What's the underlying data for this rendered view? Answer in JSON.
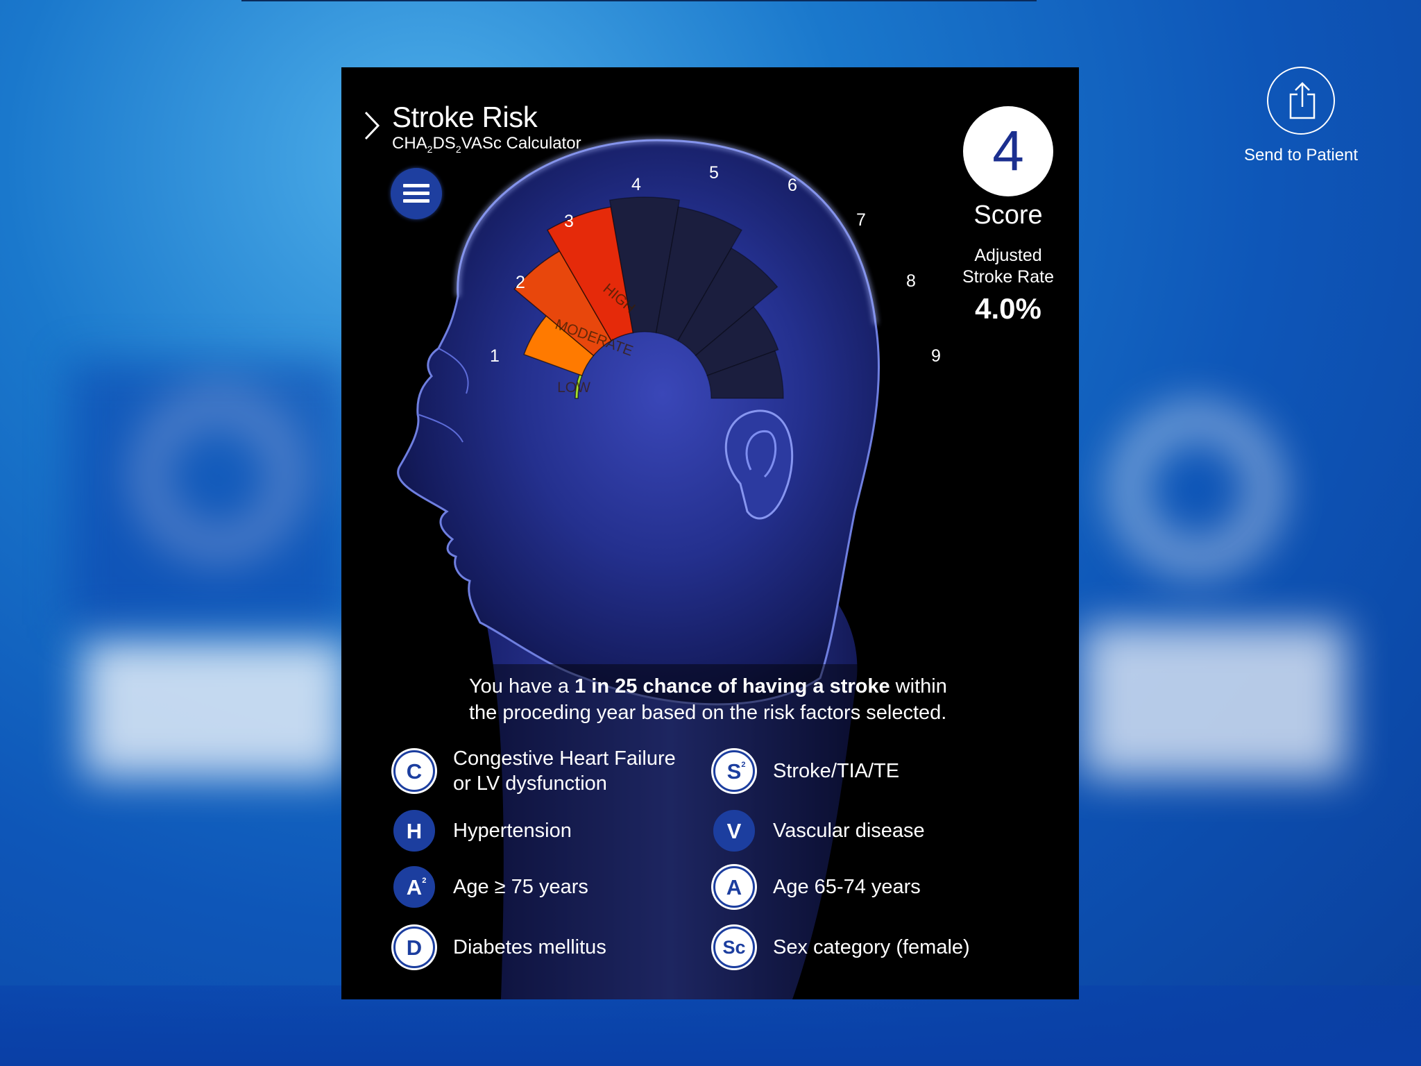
{
  "app": {
    "title": "Stroke Risk",
    "subtitle_parts": [
      "CHA",
      "2",
      "DS",
      "2",
      "VASc Calculator"
    ]
  },
  "share": {
    "label": "Send to Patient",
    "icon": "share-icon"
  },
  "score": {
    "value": "4",
    "label": "Score",
    "rate_label_line1": "Adjusted",
    "rate_label_line2": "Stroke Rate",
    "rate_value": "4.0%"
  },
  "gauge": {
    "tick_labels": [
      "1",
      "2",
      "3",
      "4",
      "5",
      "6",
      "7",
      "8",
      "9"
    ],
    "zone_labels": [
      "LOW",
      "MODERATE",
      "HIGH"
    ],
    "filled_segments": 4,
    "total_segments": 9,
    "colors": {
      "low": "#a6e22e",
      "moderate": "#ff7a00",
      "high": "#e8470c",
      "critical": "#e52a0a",
      "empty": "#1b1e3e"
    }
  },
  "summary": {
    "prefix": "You have a ",
    "emphasis": "1 in 25 chance of having a stroke",
    "suffix": " within the proceding year based on the risk factors selected."
  },
  "factors": [
    {
      "letter": "C",
      "sub": "",
      "label": "Congestive Heart Failure",
      "label2": "or LV dysfunction",
      "selected": false
    },
    {
      "letter": "S",
      "sub": "2",
      "label": "Stroke/TIA/TE",
      "label2": "",
      "selected": false
    },
    {
      "letter": "H",
      "sub": "",
      "label": "Hypertension",
      "label2": "",
      "selected": true
    },
    {
      "letter": "V",
      "sub": "",
      "label": "Vascular disease",
      "label2": "",
      "selected": true
    },
    {
      "letter": "A",
      "sub": "2",
      "label": "Age ≥ 75 years",
      "label2": "",
      "selected": true
    },
    {
      "letter": "A",
      "sub": "",
      "label": "Age 65-74 years",
      "label2": "",
      "selected": false
    },
    {
      "letter": "D",
      "sub": "",
      "label": "Diabetes mellitus",
      "label2": "",
      "selected": false
    },
    {
      "letter": "Sc",
      "sub": "",
      "label": "Sex category (female)",
      "label2": "",
      "selected": false
    }
  ]
}
